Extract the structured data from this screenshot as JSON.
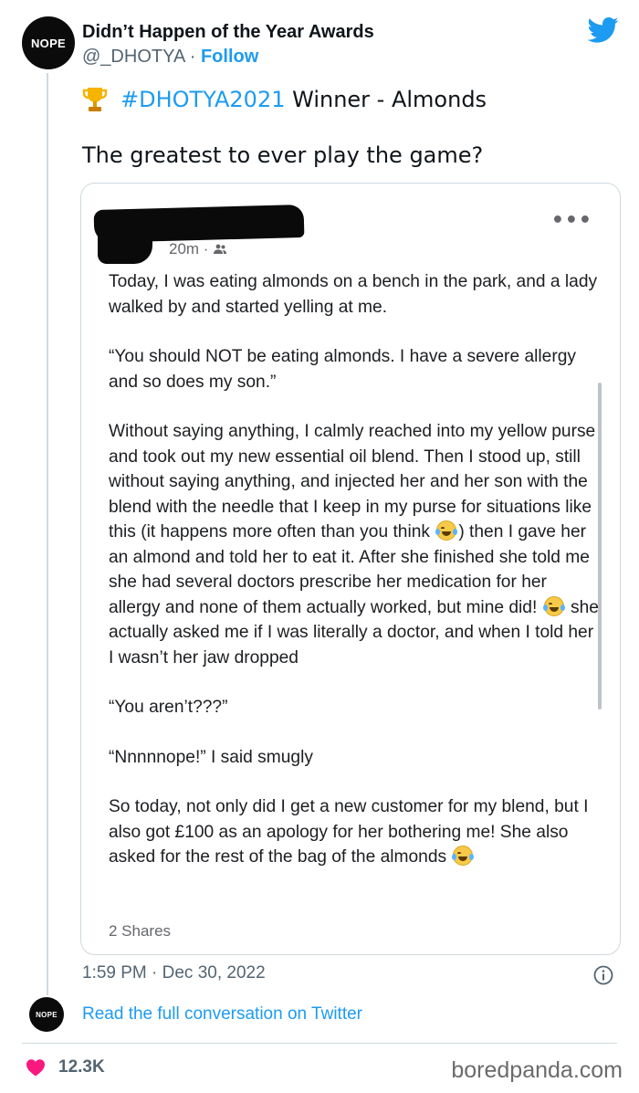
{
  "account": {
    "avatar_text": "NOPE",
    "display_name": "Didn’t Happen of the Year Awards",
    "handle": "@_DHOTYA",
    "separator": " · ",
    "follow_label": "Follow"
  },
  "tweet": {
    "hashtag": "#DHOTYA2021",
    "title_rest": " Winner - Almonds",
    "line2": "The greatest to ever play the game?",
    "timestamp": "1:59 PM · Dec 30, 2022"
  },
  "post": {
    "time": "20m ·",
    "p1": "Today, I was eating almonds on a bench in the park, and a lady walked by and started yelling at me.",
    "p2": "“You should NOT be eating almonds. I have a severe allergy and so does my son.”",
    "p3a": "Without saying anything, I calmly reached into my yellow purse and took out my new essential oil blend. Then I stood up, still without saying anything, and injected her and her son with the blend with the needle that I keep in my purse for situations like this (it happens more often than you think ",
    "p3b": ") then I gave her an almond and told her to eat it. After she finished she told me she had several doctors prescribe her medication for her allergy and none of them actually worked, but mine did! ",
    "p3c": " she actually asked me if I was literally a doctor, and when I told her I wasn’t her jaw dropped",
    "p4": "“You aren’t???”",
    "p5": "“Nnnnnope!” I said smugly",
    "p6a": "So today, not only did I get a new customer for my blend, but I also got £100 as an apology for her bothering me! She also asked for the rest of the bag of the almonds ",
    "shares": "2 Shares"
  },
  "footer": {
    "avatar_text": "NOPE",
    "read_link": "Read the full conversation on Twitter",
    "like_count": "12.3K",
    "watermark": "boredpanda.com"
  },
  "colors": {
    "twitter_blue": "#1d9bf0",
    "like_pink": "#f91880",
    "avatar_black": "#0b0b0b"
  }
}
